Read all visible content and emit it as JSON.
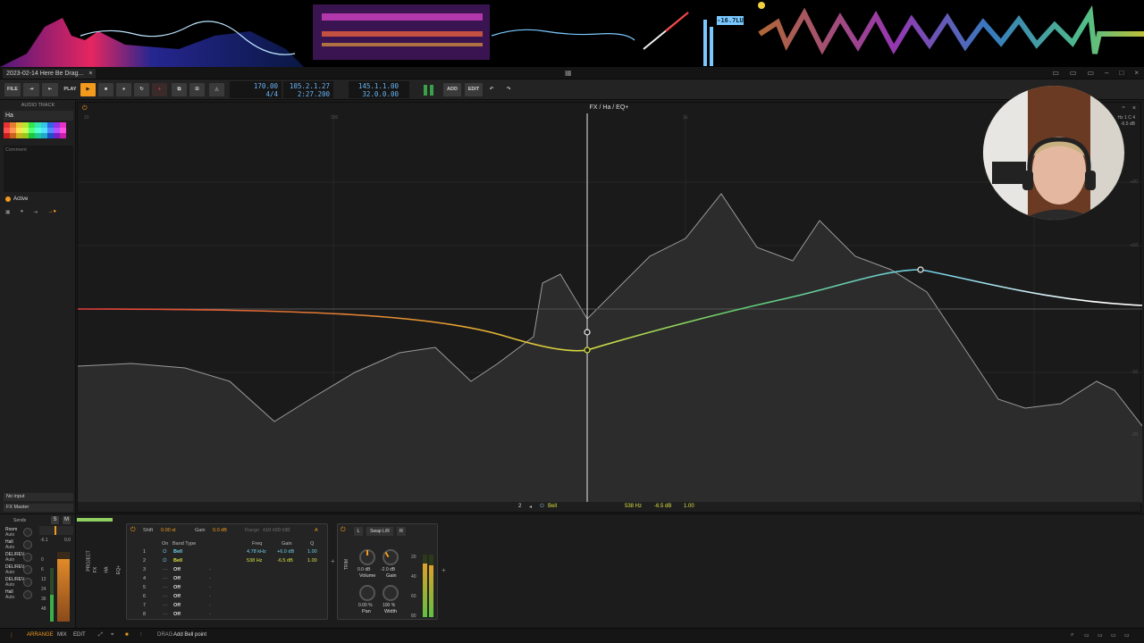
{
  "visualizer": {
    "loudness_readout": "-16.7LU"
  },
  "titlebar": {
    "tab_title": "2023-02-14 Here Be Drag...",
    "grip_glyph": "▦"
  },
  "transport": {
    "file": "FILE",
    "play": "PLAY",
    "add": "ADD",
    "edit": "EDIT",
    "tempo": "170.00",
    "time_signature": "4/4",
    "position_bars": "105.2.1.27",
    "position_time": "2:27.200",
    "loop_start": "145.1.1.00",
    "loop_length": "32.0.0.00"
  },
  "inspector": {
    "header": "AUDIO TRACK",
    "track_name": "Ha",
    "comment_placeholder": "Comment",
    "active_label": "Active",
    "input": "No input",
    "output": "FX Master",
    "swatch_colors": [
      "#e63232",
      "#e67d32",
      "#e6c832",
      "#b4e632",
      "#32e64b",
      "#32e6b4",
      "#32c8e6",
      "#3264e6",
      "#9632e6",
      "#e632c8",
      "#ff5050",
      "#ff9650",
      "#ffe150",
      "#c8ff50",
      "#50ff78",
      "#50ffd2",
      "#50e1ff",
      "#5087ff",
      "#b450ff",
      "#ff50e1",
      "#c81e1e",
      "#c8641e",
      "#c8b41e",
      "#96c81e",
      "#1ec83c",
      "#1ec896",
      "#1eaac8",
      "#1e50c8",
      "#781ec8",
      "#c81eaa"
    ]
  },
  "eq": {
    "title": "FX / Ha / EQ+",
    "freq_labels": [
      "20",
      "100",
      "1k"
    ],
    "db_labels": [
      "+20",
      "+10",
      "-10",
      "-20"
    ],
    "footer": {
      "band": "2",
      "band_type": "Bell",
      "freq": "538 Hz",
      "gain": "-6.5 dB",
      "q": "1.00"
    },
    "right_info": "Hz  1 C 4",
    "right_info_2": "-6.5 dB",
    "colors": {
      "curve_low": "#e03a3a",
      "curve_mid": "#d8e040",
      "curve_high": "#70d0e8"
    }
  },
  "sends": {
    "label": "Sends",
    "s": "S",
    "m": "M",
    "items": [
      {
        "name": "Room",
        "mode": "Auto"
      },
      {
        "name": "Hall",
        "mode": "Auto"
      },
      {
        "name": "DEL/REV",
        "mode": "Auto"
      },
      {
        "name": "DEL/REV",
        "mode": "Auto"
      },
      {
        "name": "DEL/REV",
        "mode": "Auto"
      },
      {
        "name": "Hall",
        "mode": "Auto"
      }
    ],
    "meter_scale": [
      "0",
      "6",
      "12",
      "24",
      "36",
      "48"
    ],
    "fader_value": "-6.1",
    "fader_value_2": "0.0"
  },
  "chain": {
    "project": "PROJECT",
    "fx": "FX",
    "ha": "HA",
    "eq": "EQ+",
    "trim": "TRIM"
  },
  "eq_device": {
    "shift_label": "Shift",
    "shift_value": "0.00 st",
    "gain_label": "Gain",
    "gain_value": "0.0 dB",
    "range_label": "Range",
    "range_options": "±10  ±20  ±30",
    "headers": {
      "on": "On",
      "band_type": "Band Type",
      "freq": "Freq",
      "gain": "Gain",
      "q": "Q"
    },
    "bands": [
      {
        "num": "1",
        "type": "Bell",
        "freq": "4.78 kHz",
        "gain": "+6.0 dB",
        "q": "1.00"
      },
      {
        "num": "2",
        "type": "Bell",
        "freq": "538 Hz",
        "gain": "-6.5 dB",
        "q": "1.00"
      },
      {
        "num": "3",
        "type": "Off",
        "freq": "-",
        "gain": "",
        "q": ""
      },
      {
        "num": "4",
        "type": "Off",
        "freq": "-",
        "gain": "",
        "q": ""
      },
      {
        "num": "5",
        "type": "Off",
        "freq": "-",
        "gain": "",
        "q": ""
      },
      {
        "num": "6",
        "type": "Off",
        "freq": "-",
        "gain": "",
        "q": ""
      },
      {
        "num": "7",
        "type": "Off",
        "freq": "-",
        "gain": "",
        "q": ""
      },
      {
        "num": "8",
        "type": "Off",
        "freq": "-",
        "gain": "",
        "q": ""
      }
    ]
  },
  "trim_device": {
    "left": "L",
    "swap": "Swap L/R",
    "right": "R",
    "volume_value": "0.0 dB",
    "volume_label": "Volume",
    "gain_value": "-2.0 dB",
    "gain_label": "Gain",
    "pan_value": "0.00 %",
    "pan_label": "Pan",
    "width_value": "100 %",
    "width_label": "Width",
    "meter_scale": [
      "20",
      "40",
      "60",
      "80"
    ]
  },
  "status": {
    "arrange": "ARRANGE",
    "mix": "MIX",
    "edit": "EDIT",
    "drag": "DRAG",
    "hint": "Add Bell point"
  }
}
